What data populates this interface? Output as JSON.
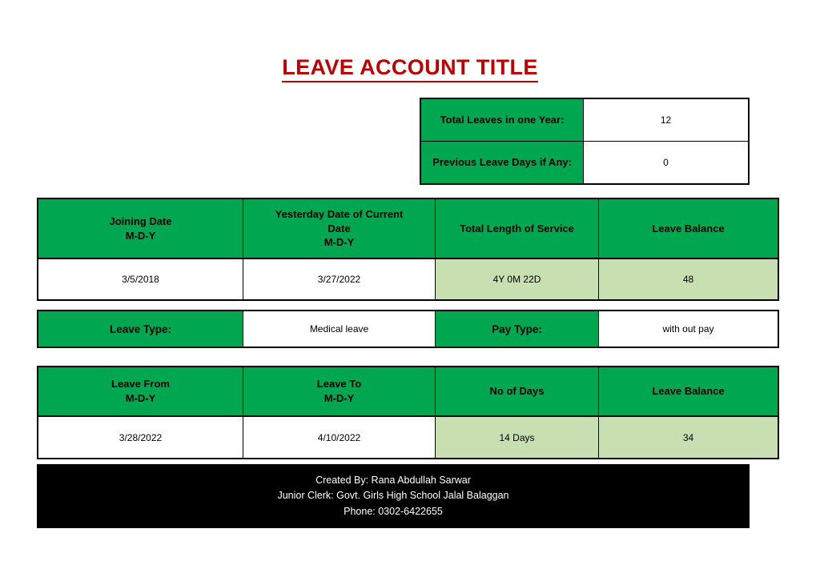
{
  "document": {
    "title": "LEAVE ACCOUNT TITLE",
    "title_color": "#C00000",
    "header_fill": "#00A650",
    "calc_fill": "#C8DFB2",
    "footer_fill": "#000000"
  },
  "summary": {
    "rows": [
      {
        "label": "Total Leaves in one Year:",
        "value": "12"
      },
      {
        "label": "Previous Leave Days if Any:",
        "value": "0"
      }
    ]
  },
  "service": {
    "headers": [
      "Joining Date\nM-D-Y",
      "Yesterday Date of Current Date\nM-D-Y",
      "Total Length of Service",
      "Leave Balance"
    ],
    "headers_line1": [
      "Joining Date",
      "Yesterday Date of Current",
      "Total Length of Service",
      "Leave Balance"
    ],
    "headers_line2": [
      "M-D-Y",
      "Date",
      "",
      ""
    ],
    "headers_line3": [
      "",
      "M-D-Y",
      "",
      ""
    ],
    "values": [
      "3/5/2018",
      "3/27/2022",
      "4Y 0M 22D",
      "48"
    ]
  },
  "leave_type": {
    "leave_type_label": "Leave Type:",
    "leave_type_value": "Medical leave",
    "pay_type_label": "Pay Type:",
    "pay_type_value": "with out pay"
  },
  "leave_period": {
    "headers_line1": [
      "Leave From",
      "Leave To",
      "No of Days",
      "Leave Balance"
    ],
    "headers_line2": [
      "M-D-Y",
      "M-D-Y",
      "",
      ""
    ],
    "values": [
      "3/28/2022",
      "4/10/2022",
      "14 Days",
      "34"
    ]
  },
  "footer": {
    "line1": "Created By: Rana Abdullah Sarwar",
    "line2": "Junior Clerk: Govt. Girls High School Jalal Balaggan",
    "line3": "Phone: 0302-6422655"
  }
}
